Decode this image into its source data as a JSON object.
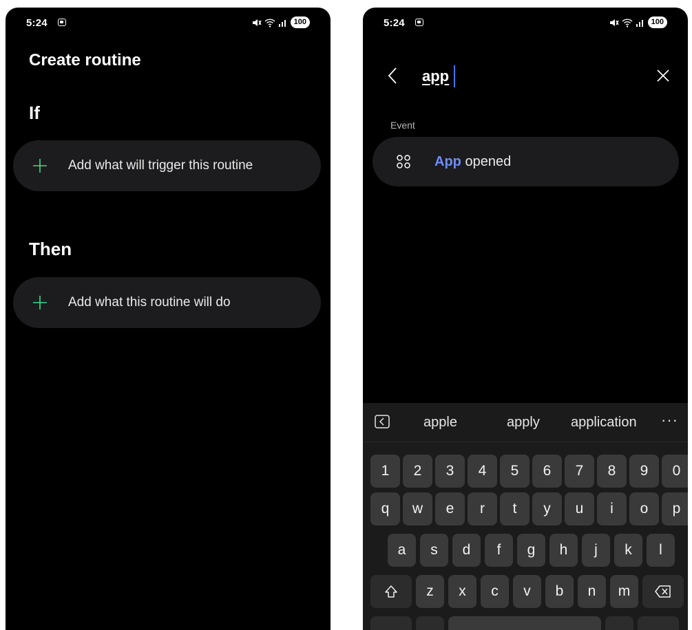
{
  "left_screen": {
    "status": {
      "time": "5:24",
      "battery": "100"
    },
    "title": "Create routine",
    "if_section": {
      "title": "If",
      "add_label": "Add what will trigger this routine"
    },
    "then_section": {
      "title": "Then",
      "add_label": "Add what this routine will do"
    }
  },
  "right_screen": {
    "status": {
      "time": "5:24",
      "battery": "100"
    },
    "search": {
      "value": "app"
    },
    "group_label": "Event",
    "result": {
      "match": "App",
      "rest": " opened"
    },
    "keyboard": {
      "suggestions": [
        "apple",
        "apply",
        "application"
      ],
      "more": "···",
      "rows": {
        "numbers": [
          "1",
          "2",
          "3",
          "4",
          "5",
          "6",
          "7",
          "8",
          "9",
          "0"
        ],
        "row1": [
          "q",
          "w",
          "e",
          "r",
          "t",
          "y",
          "u",
          "i",
          "o",
          "p"
        ],
        "row2": [
          "a",
          "s",
          "d",
          "f",
          "g",
          "h",
          "j",
          "k",
          "l"
        ],
        "row3": [
          "z",
          "x",
          "c",
          "v",
          "b",
          "n",
          "m"
        ]
      }
    }
  },
  "colors": {
    "background": "#000000",
    "card": "#1c1c1e",
    "accent_green": "#3ddc84",
    "accent_blue": "#6d8dff",
    "caret": "#3d7bff"
  },
  "icons": {
    "plus": "plus-icon",
    "back": "chevron-left-icon",
    "clear": "close-icon",
    "apps": "apps-grid-icon",
    "shift": "shift-icon",
    "backspace": "backspace-icon",
    "collapse": "keyboard-collapse-icon"
  }
}
